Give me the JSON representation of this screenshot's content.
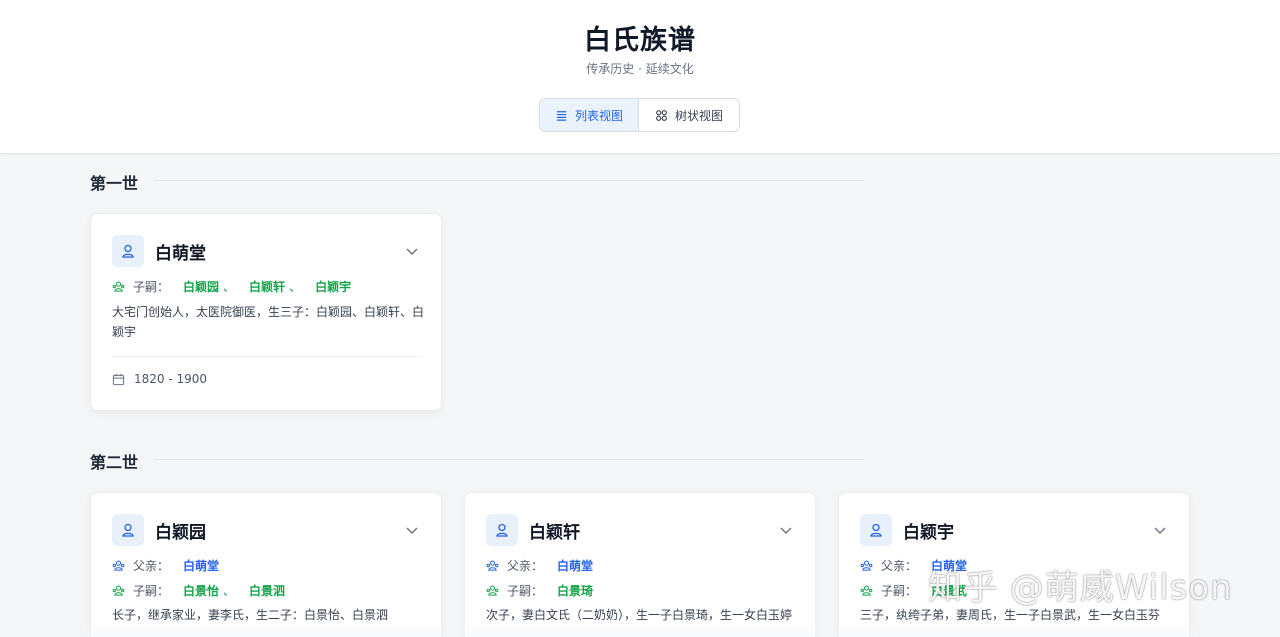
{
  "header": {
    "title": "白氏族谱",
    "subtitle": "传承历史 · 延续文化",
    "views": {
      "list": "列表视图",
      "tree": "树状视图"
    }
  },
  "labels": {
    "father": "父亲：",
    "children": "子嗣：",
    "sep": "、"
  },
  "generations": [
    {
      "title": "第一世",
      "members": [
        {
          "name": "白萌堂",
          "children": [
            "白颖园",
            "白颖轩",
            "白颖宇"
          ],
          "desc": "大宅门创始人，太医院御医，生三子：白颖园、白颖轩、白颖宇",
          "years": "1820 - 1900"
        }
      ]
    },
    {
      "title": "第二世",
      "members": [
        {
          "name": "白颖园",
          "father": "白萌堂",
          "children": [
            "白景怡",
            "白景泗"
          ],
          "desc": "长子，继承家业，妻李氏，生二子：白景怡、白景泗"
        },
        {
          "name": "白颖轩",
          "father": "白萌堂",
          "children": [
            "白景琦"
          ],
          "desc": "次子，妻白文氏（二奶奶），生一子白景琦，生一女白玉婷"
        },
        {
          "name": "白颖宇",
          "father": "白萌堂",
          "children": [
            "白景武"
          ],
          "desc": "三子，纨绔子弟，妻周氏，生一子白景武，生一女白玉芬"
        }
      ]
    }
  ],
  "watermark": "知乎 @萌威Wilson",
  "colors": {
    "accent": "#2563eb",
    "child_link": "#16a34a",
    "avatar_bg": "#e8f0fc"
  }
}
